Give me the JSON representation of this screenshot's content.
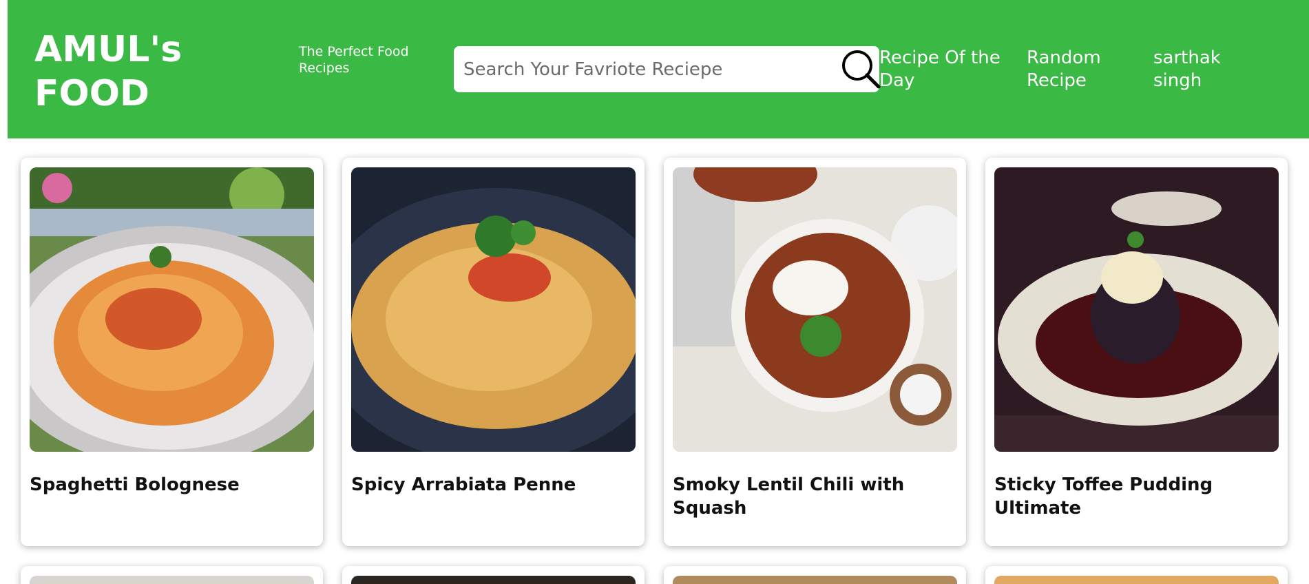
{
  "header": {
    "brand": "AMUL's FOOD",
    "tagline": "The Perfect Food Recipes",
    "search": {
      "placeholder": "Search Your Favriote Reciepe",
      "value": ""
    },
    "search_icon": "magnifier-icon",
    "nav": {
      "recipe_of_day": "Recipe Of the Day",
      "random_recipe": "Random Recipe",
      "user": "sarthak singh"
    }
  },
  "colors": {
    "header_bg": "#3ab944",
    "header_text": "#ffffff",
    "card_bg": "#ffffff"
  },
  "recipes": [
    {
      "title": "Spaghetti Bolognese",
      "image": "spaghetti-bolognese-photo"
    },
    {
      "title": "Spicy Arrabiata Penne",
      "image": "arrabiata-penne-photo"
    },
    {
      "title": "Smoky Lentil Chili with Squash",
      "image": "lentil-chili-photo"
    },
    {
      "title": "Sticky Toffee Pudding Ultimate",
      "image": "toffee-pudding-photo"
    }
  ]
}
